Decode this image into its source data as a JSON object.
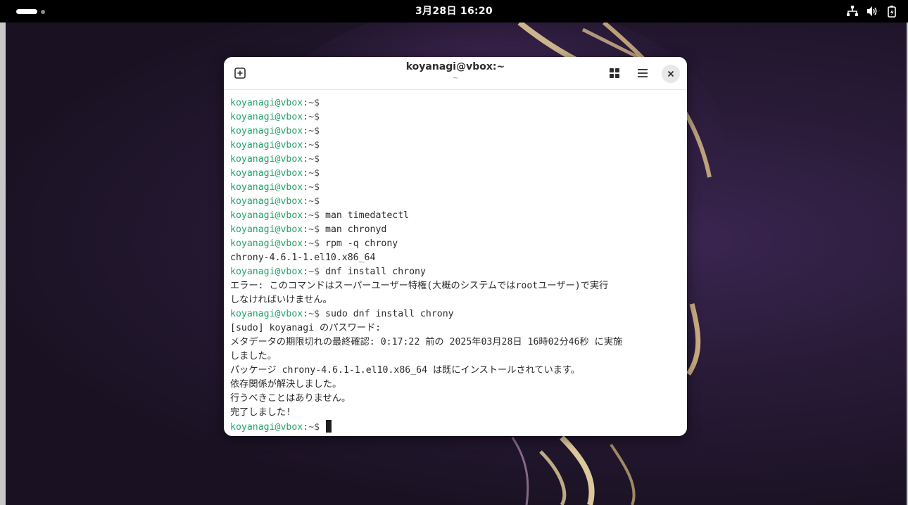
{
  "topbar": {
    "clock": "3月28日 16:20",
    "icons": [
      "network-icon",
      "volume-icon",
      "battery-icon"
    ]
  },
  "window": {
    "title": "koyanagi@vbox:~",
    "subtitle": "~"
  },
  "prompt": {
    "user_host": "koyanagi@vbox",
    "path": ":~",
    "symbol": "$ ",
    "color": "#26a269"
  },
  "terminal": {
    "commands": {
      "c1": "man timedatectl",
      "c2": "man chronyd",
      "c3": "rpm -q chrony",
      "c4": "dnf install chrony",
      "c5": "sudo dnf install chrony"
    },
    "output": {
      "o1": "chrony-4.6.1-1.el10.x86_64",
      "o2": "エラー: このコマンドはスーパーユーザー特権(大概のシステムではrootユーザー)で実行",
      "o3": "しなければいけません。",
      "o4": "[sudo] koyanagi のパスワード:",
      "o5": "メタデータの期限切れの最終確認: 0:17:22 前の 2025年03月28日 16時02分46秒 に実施",
      "o6": "しました。",
      "o7": "パッケージ chrony-4.6.1-1.el10.x86_64 は既にインストールされています。",
      "o8": "依存関係が解決しました。",
      "o9": "行うべきことはありません。",
      "o10": "完了しました!"
    }
  }
}
